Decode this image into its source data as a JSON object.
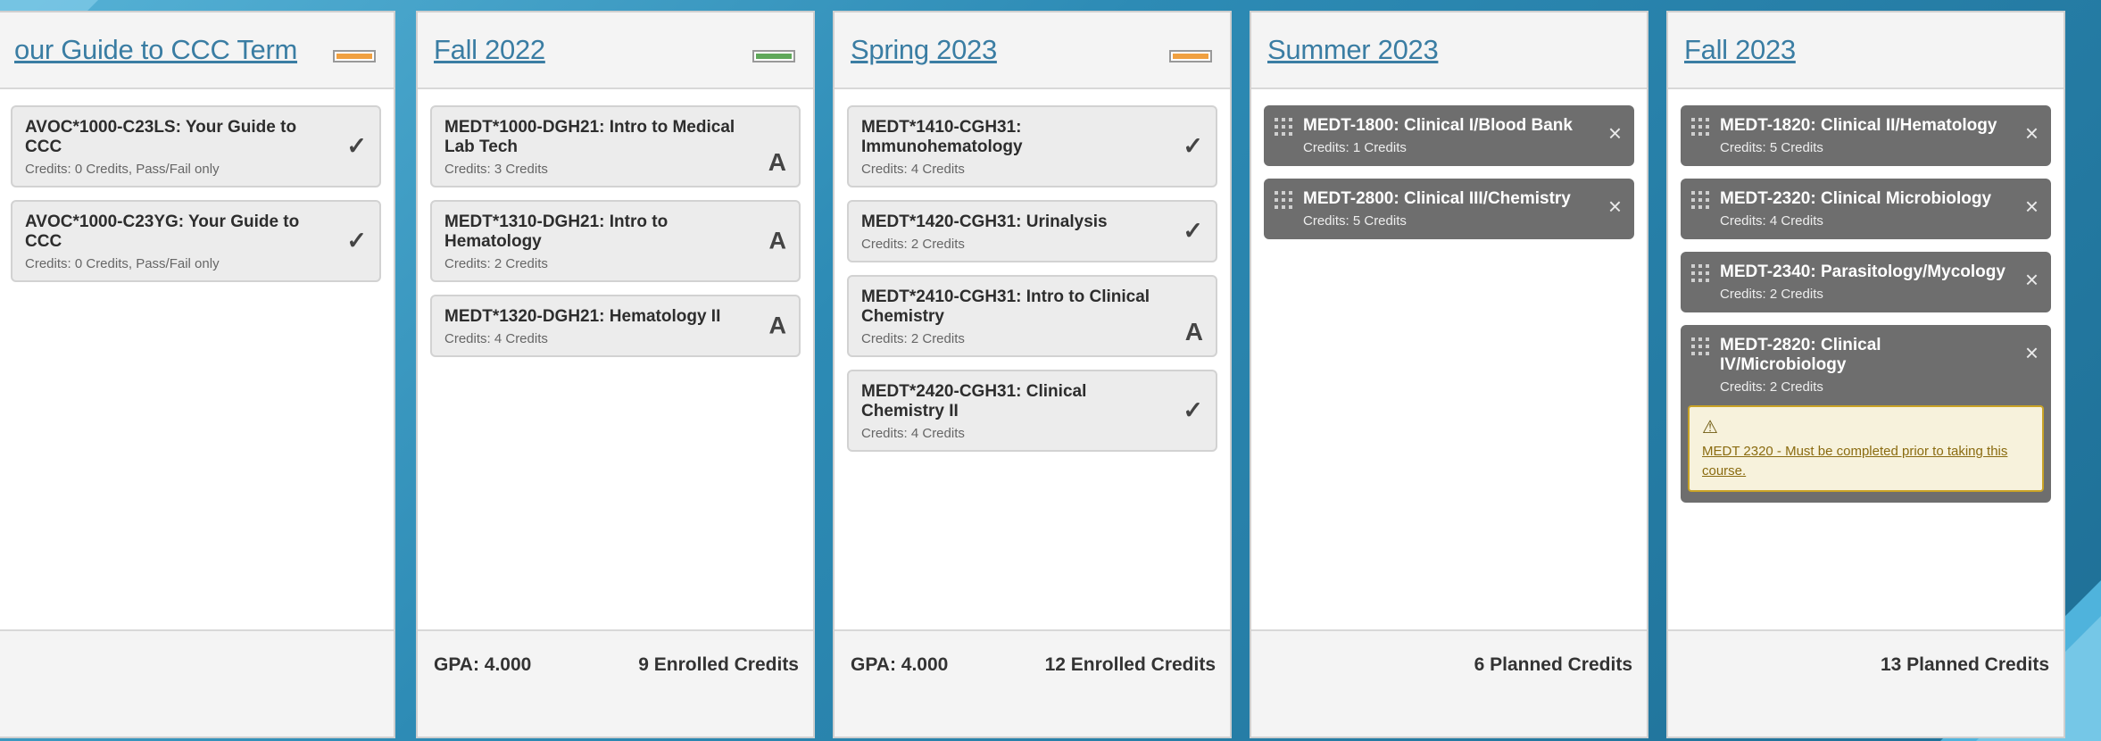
{
  "colors": {
    "status_orange": "#f0a040",
    "status_green": "#5fa85a"
  },
  "terms": [
    {
      "title": "our Guide to CCC Term",
      "status": "orange",
      "courses": [
        {
          "code": "AVOC*1000-C23LS: Your Guide to CCC",
          "credits": "Credits: 0 Credits, Pass/Fail only",
          "mark": "✓"
        },
        {
          "code": "AVOC*1000-C23YG: Your Guide to CCC",
          "credits": "Credits: 0 Credits, Pass/Fail only",
          "mark": "✓"
        }
      ],
      "gpa": "",
      "total": ""
    },
    {
      "title": "Fall 2022",
      "status": "green",
      "courses": [
        {
          "code": "MEDT*1000-DGH21: Intro to Medical Lab Tech",
          "credits": "Credits: 3 Credits",
          "mark": "A"
        },
        {
          "code": "MEDT*1310-DGH21: Intro to Hematology",
          "credits": "Credits: 2 Credits",
          "mark": "A"
        },
        {
          "code": "MEDT*1320-DGH21: Hematology II",
          "credits": "Credits: 4 Credits",
          "mark": "A"
        }
      ],
      "gpa": "GPA: 4.000",
      "total": "9 Enrolled Credits"
    },
    {
      "title": "Spring 2023",
      "status": "orange",
      "courses": [
        {
          "code": "MEDT*1410-CGH31: Immunohematology",
          "credits": "Credits: 4 Credits",
          "mark": "✓"
        },
        {
          "code": "MEDT*1420-CGH31: Urinalysis",
          "credits": "Credits: 2 Credits",
          "mark": "✓"
        },
        {
          "code": "MEDT*2410-CGH31: Intro to Clinical Chemistry",
          "credits": "Credits: 2 Credits",
          "mark": "A"
        },
        {
          "code": "MEDT*2420-CGH31: Clinical Chemistry II",
          "credits": "Credits: 4 Credits",
          "mark": "✓"
        }
      ],
      "gpa": "GPA: 4.000",
      "total": "12 Enrolled Credits"
    },
    {
      "title": "Summer 2023",
      "planned": [
        {
          "code": "MEDT-1800: Clinical I/Blood Bank",
          "credits": "Credits: 1 Credits"
        },
        {
          "code": "MEDT-2800: Clinical III/Chemistry",
          "credits": "Credits: 5 Credits"
        }
      ],
      "total": "6 Planned Credits"
    },
    {
      "title": "Fall 2023",
      "planned": [
        {
          "code": "MEDT-1820: Clinical II/Hematology",
          "credits": "Credits: 5 Credits"
        },
        {
          "code": "MEDT-2320: Clinical Microbiology",
          "credits": "Credits: 4 Credits"
        },
        {
          "code": "MEDT-2340: Parasitology/Mycology",
          "credits": "Credits: 2 Credits"
        },
        {
          "code": "MEDT-2820: Clinical IV/Microbiology",
          "credits": "Credits: 2 Credits"
        }
      ],
      "warning": {
        "icon": "warning-icon",
        "text": "MEDT 2320 - Must be completed prior to taking this course."
      },
      "total": "13 Planned Credits"
    }
  ],
  "icons": {
    "close": "×",
    "check": "✓"
  }
}
